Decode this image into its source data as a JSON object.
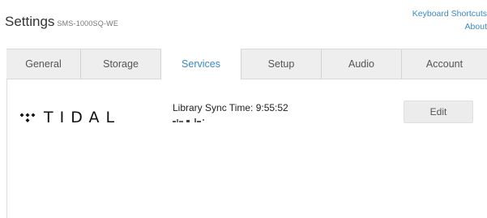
{
  "header": {
    "title": "Settings",
    "model": "SMS-1000SQ-WE",
    "links": [
      "Keyboard Shortcuts",
      "About"
    ]
  },
  "tabs": [
    {
      "label": "General",
      "active": false
    },
    {
      "label": "Storage",
      "active": false
    },
    {
      "label": "Services",
      "active": true
    },
    {
      "label": "Setup",
      "active": false
    },
    {
      "label": "Audio",
      "active": false
    },
    {
      "label": "Account",
      "active": false
    }
  ],
  "service": {
    "logo_text": "TIDAL",
    "logo_icon": "tidal-diamonds-icon",
    "sync_label": "Library Sync Time: 9:55:52",
    "edit_label": "Edit"
  },
  "colors": {
    "accent": "#3a89c4",
    "tab_bar": "#eeeeee",
    "button_bg": "#ececec"
  }
}
